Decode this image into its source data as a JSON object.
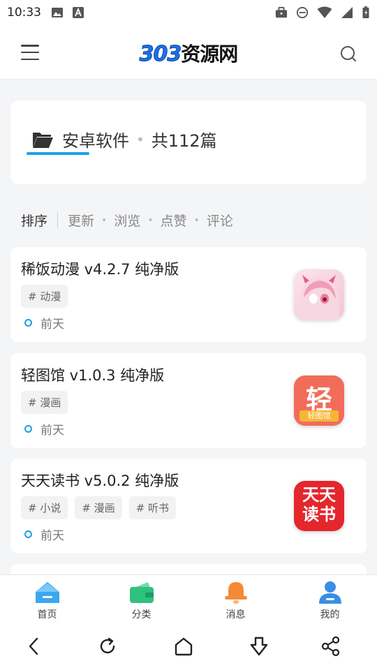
{
  "status": {
    "time": "10:33"
  },
  "header": {
    "logo_num": "303",
    "logo_text": "资源网"
  },
  "category": {
    "name": "安卓软件",
    "count": "共112篇"
  },
  "sort": {
    "label": "排序",
    "options": [
      "更新",
      "浏览",
      "点赞",
      "评论"
    ]
  },
  "items": [
    {
      "title": "稀饭动漫 v4.2.7 纯净版",
      "tags": [
        "# 动漫"
      ],
      "time": "前天"
    },
    {
      "title": "轻图馆 v1.0.3 纯净版",
      "tags": [
        "# 漫画"
      ],
      "time": "前天"
    },
    {
      "title": "天天读书 v5.0.2 纯净版",
      "tags": [
        "# 小说",
        "# 漫画",
        "# 听书"
      ],
      "time": "前天"
    }
  ],
  "thumbs": {
    "light_text": "轻",
    "light_sub": "轻图馆",
    "tiantian_text": "天天读书"
  },
  "nav": {
    "home": "首页",
    "category": "分类",
    "message": "消息",
    "mine": "我的"
  },
  "colors": {
    "accent": "#1aa1e6",
    "home": "#3ba7f0",
    "category": "#2ec27e",
    "message": "#f58a35",
    "mine": "#3a8ee6"
  }
}
